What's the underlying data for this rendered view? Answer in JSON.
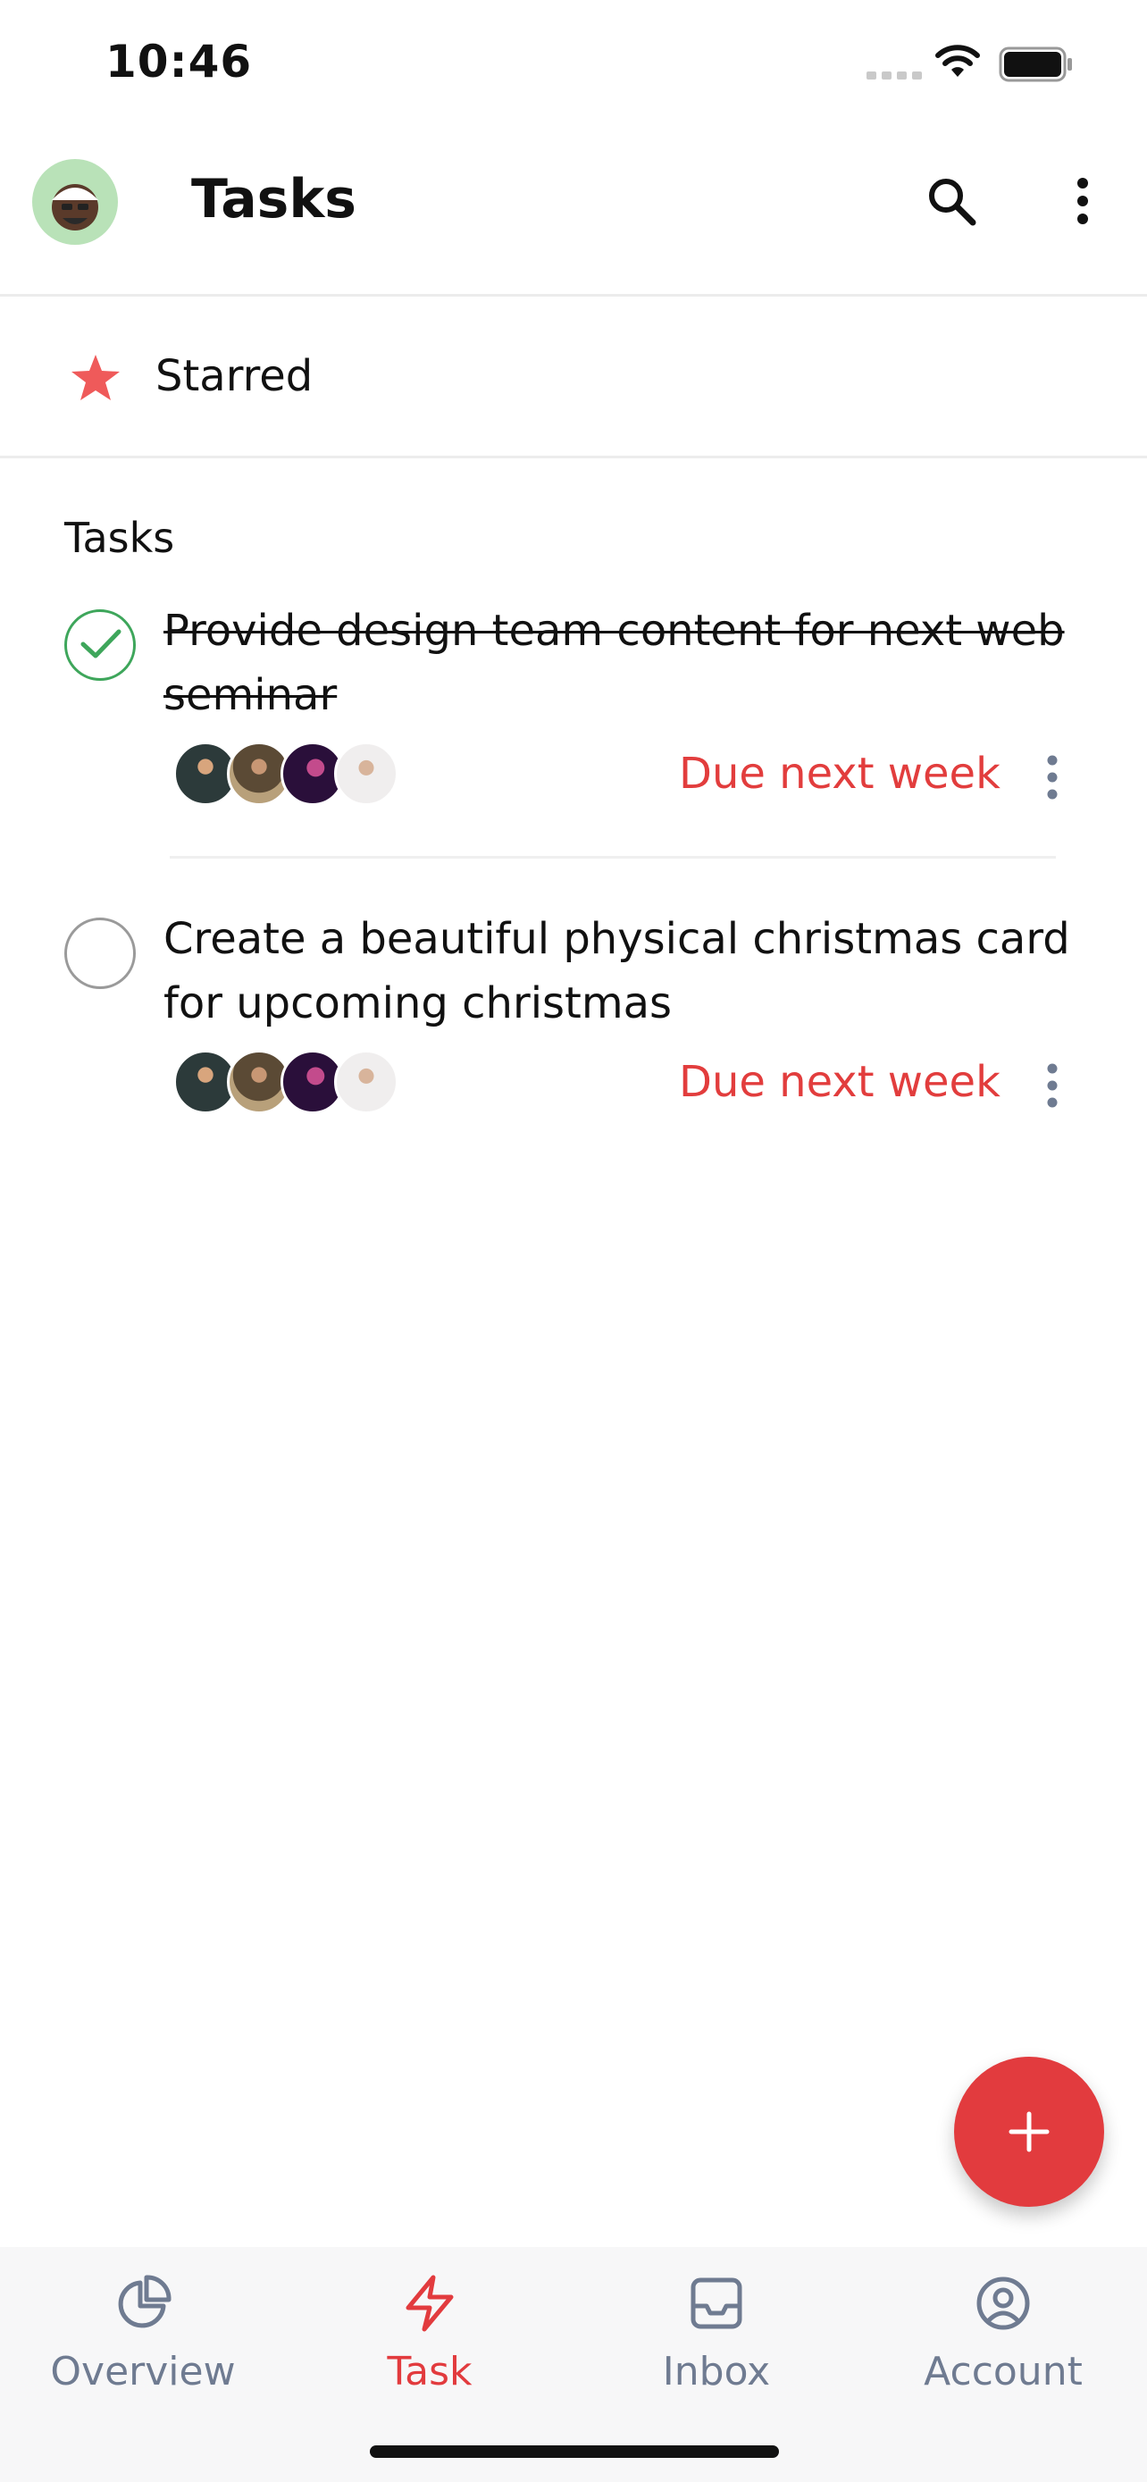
{
  "status_bar": {
    "time": "10:46"
  },
  "header": {
    "title": "Tasks"
  },
  "starred": {
    "label": "Starred"
  },
  "tasks_section": {
    "title": "Tasks"
  },
  "tasks": [
    {
      "text": "Provide design team content for next web seminar",
      "completed": true,
      "due": "Due next week"
    },
    {
      "text": "Create a beautiful physical christmas card for upcoming christmas",
      "completed": false,
      "due": "Due next week"
    }
  ],
  "bottom_nav": {
    "items": [
      {
        "label": "Overview",
        "icon": "pie-chart-icon",
        "active": false
      },
      {
        "label": "Task",
        "icon": "lightning-icon",
        "active": true
      },
      {
        "label": "Inbox",
        "icon": "inbox-icon",
        "active": false
      },
      {
        "label": "Account",
        "icon": "user-circle-icon",
        "active": false
      }
    ]
  },
  "colors": {
    "accent": "#e23b3e",
    "done": "#3ea65b",
    "nav_inactive": "#6f7b91"
  }
}
